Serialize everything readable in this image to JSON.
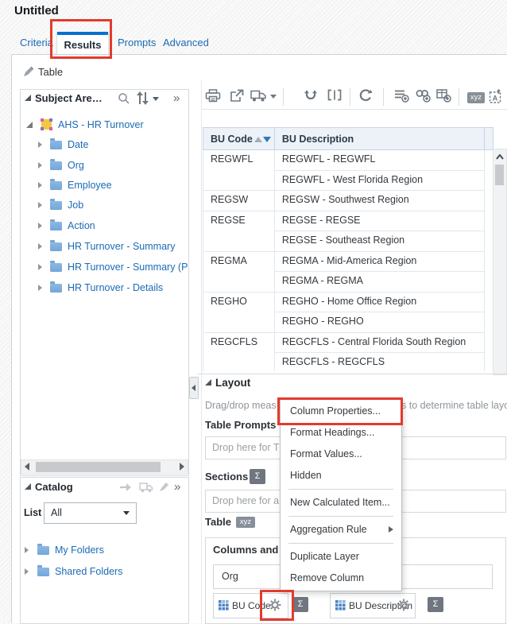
{
  "page": {
    "title": "Untitled"
  },
  "tabs": [
    {
      "label": "Criteria",
      "active": false
    },
    {
      "label": "Results",
      "active": true
    },
    {
      "label": "Prompts",
      "active": false
    },
    {
      "label": "Advanced",
      "active": false
    }
  ],
  "view": {
    "title": "Table"
  },
  "subject_areas": {
    "title": "Subject Are…",
    "root": "AHS - HR Turnover",
    "folders": [
      "Date",
      "Org",
      "Employee",
      "Job",
      "Action",
      "HR Turnover - Summary",
      "HR Turnover - Summary (P",
      "HR Turnover - Details"
    ]
  },
  "catalog": {
    "title": "Catalog",
    "list_label": "List",
    "list_value": "All",
    "folders": [
      "My Folders",
      "Shared Folders"
    ]
  },
  "toolbar": {
    "icons": [
      "print",
      "export",
      "schedule",
      "preview",
      "rename",
      "refresh",
      "new-view",
      "new-group",
      "new-calculated-item",
      "selection-steps",
      "import-formatting"
    ],
    "xyz_label": "xyz"
  },
  "results_table": {
    "columns": [
      "BU Code",
      "BU Description"
    ],
    "sorted_column": "BU Code",
    "rows": [
      {
        "code": "REGWFL",
        "descriptions": [
          "REGWFL - REGWFL",
          "REGWFL - West Florida Region"
        ]
      },
      {
        "code": "REGSW",
        "descriptions": [
          "REGSW - Southwest Region"
        ]
      },
      {
        "code": "REGSE",
        "descriptions": [
          "REGSE - REGSE",
          "REGSE - Southeast Region"
        ]
      },
      {
        "code": "REGMA",
        "descriptions": [
          "REGMA - Mid-America Region",
          "REGMA - REGMA"
        ]
      },
      {
        "code": "REGHO",
        "descriptions": [
          "REGHO - Home Office Region",
          "REGHO - REGHO"
        ]
      },
      {
        "code": "REGCFLS",
        "descriptions": [
          "REGCFLS - Central Florida South Region",
          "REGCFLS - REGCFLS"
        ]
      }
    ]
  },
  "layout_pane": {
    "title": "Layout",
    "hint_left": "Drag/drop meas",
    "hint_right": "s to determine table layou",
    "table_prompts_label": "Table Prompts",
    "table_prompts_placeholder": "Drop here for T",
    "sections_label": "Sections",
    "sections_placeholder": "Drop here for a",
    "sigma_label": "Σ",
    "table_label": "Table",
    "xyz_label": "xyz",
    "columns_section_label": "Columns and",
    "group_label": "Org",
    "pills": [
      {
        "label": "BU Code"
      },
      {
        "label": "BU Description"
      }
    ]
  },
  "context_menu": {
    "items": [
      {
        "label": "Column Properties...",
        "highlighted": true
      },
      {
        "label": "Format Headings..."
      },
      {
        "label": "Format Values..."
      },
      {
        "label": "Hidden"
      },
      {
        "separator": true
      },
      {
        "label": "New Calculated Item..."
      },
      {
        "separator": true
      },
      {
        "label": "Aggregation Rule",
        "has_submenu": true
      },
      {
        "separator": true
      },
      {
        "label": "Duplicate Layer"
      },
      {
        "label": "Remove Column"
      }
    ]
  },
  "annotations": {
    "color": "#e23b2e"
  }
}
